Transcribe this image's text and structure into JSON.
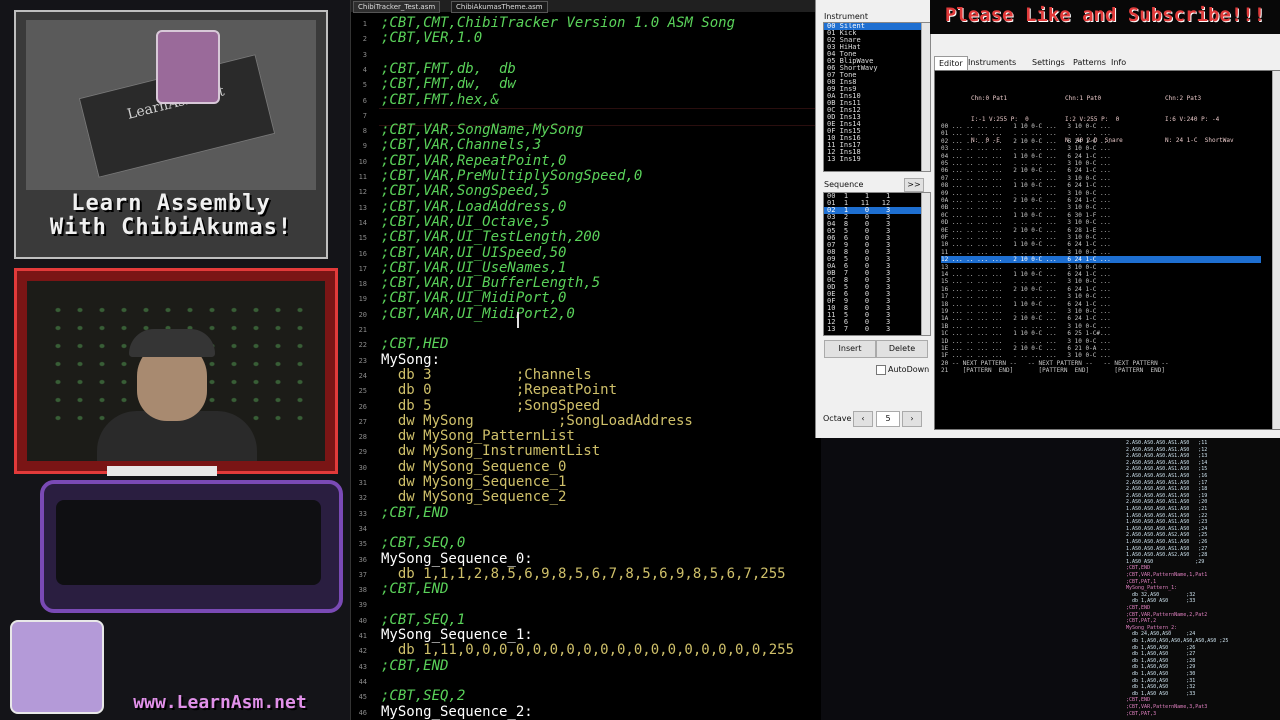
{
  "overlay": {
    "logo_site": "LearnAsm.net",
    "logo_title_1": "Learn Assembly",
    "logo_title_2": "With ChibiAkumas!",
    "url": "www.LearnAsm.net"
  },
  "editor": {
    "tabs": [
      "ChibiTracker_Test.asm",
      "ChibiAkumasTheme.asm"
    ],
    "lines": [
      {
        "n": "1",
        "t": ";CBT,CMT,ChibiTracker Version 1.0 ASM Song",
        "c": "cmt"
      },
      {
        "n": "2",
        "t": ";CBT,VER,1.0",
        "c": "cmt"
      },
      {
        "n": "3",
        "t": "",
        "c": "cmt"
      },
      {
        "n": "4",
        "t": ";CBT,FMT,db,  db",
        "c": "cmt"
      },
      {
        "n": "5",
        "t": ";CBT,FMT,dw,  dw",
        "c": "cmt"
      },
      {
        "n": "6",
        "t": ";CBT,FMT,hex,&",
        "c": "cmt"
      },
      {
        "n": "7",
        "t": "",
        "c": "cmt"
      },
      {
        "n": "8",
        "t": ";CBT,VAR,SongName,MySong",
        "c": "cmt"
      },
      {
        "n": "9",
        "t": ";CBT,VAR,Channels,3",
        "c": "cmt"
      },
      {
        "n": "10",
        "t": ";CBT,VAR,RepeatPoint,0",
        "c": "cmt"
      },
      {
        "n": "11",
        "t": ";CBT,VAR,PreMultiplySongSpeed,0",
        "c": "cmt"
      },
      {
        "n": "12",
        "t": ";CBT,VAR,SongSpeed,5",
        "c": "cmt"
      },
      {
        "n": "13",
        "t": ";CBT,VAR,LoadAddress,0",
        "c": "cmt"
      },
      {
        "n": "14",
        "t": ";CBT,VAR,UI_Octave,5",
        "c": "cmt"
      },
      {
        "n": "15",
        "t": ";CBT,VAR,UI_TestLength,200",
        "c": "cmt"
      },
      {
        "n": "16",
        "t": ";CBT,VAR,UI_UISpeed,50",
        "c": "cmt"
      },
      {
        "n": "17",
        "t": ";CBT,VAR,UI_UseNames,1",
        "c": "cmt"
      },
      {
        "n": "18",
        "t": ";CBT,VAR,UI_BufferLength,5",
        "c": "cmt"
      },
      {
        "n": "19",
        "t": ";CBT,VAR,UI_MidiPort,0",
        "c": "cmt"
      },
      {
        "n": "20",
        "t": ";CBT,VAR,UI_MidiPort2,0",
        "c": "cmt"
      },
      {
        "n": "21",
        "t": "",
        "c": "cmt"
      },
      {
        "n": "22",
        "t": ";CBT,HED",
        "c": "cmt"
      },
      {
        "n": "23",
        "t": "MySong:",
        "c": "lbl"
      },
      {
        "n": "24",
        "t": "  db 3          ;Channels",
        "c": "mix"
      },
      {
        "n": "25",
        "t": "  db 0          ;RepeatPoint",
        "c": "mix"
      },
      {
        "n": "26",
        "t": "  db 5          ;SongSpeed",
        "c": "mix"
      },
      {
        "n": "27",
        "t": "  dw MySong          ;SongLoadAddress",
        "c": "mix"
      },
      {
        "n": "28",
        "t": "  dw MySong_PatternList",
        "c": "kw"
      },
      {
        "n": "29",
        "t": "  dw MySong_InstrumentList",
        "c": "kw"
      },
      {
        "n": "30",
        "t": "  dw MySong_Sequence_0",
        "c": "kw"
      },
      {
        "n": "31",
        "t": "  dw MySong_Sequence_1",
        "c": "kw"
      },
      {
        "n": "32",
        "t": "  dw MySong_Sequence_2",
        "c": "kw"
      },
      {
        "n": "33",
        "t": ";CBT,END",
        "c": "cmt"
      },
      {
        "n": "34",
        "t": "",
        "c": "cmt"
      },
      {
        "n": "35",
        "t": ";CBT,SEQ,0",
        "c": "cmt"
      },
      {
        "n": "36",
        "t": "MySong_Sequence_0:",
        "c": "lbl"
      },
      {
        "n": "37",
        "t": "  db 1,1,1,2,8,5,6,9,8,5,6,7,8,5,6,9,8,5,6,7,255",
        "c": "kw"
      },
      {
        "n": "38",
        "t": ";CBT,END",
        "c": "cmt"
      },
      {
        "n": "39",
        "t": "",
        "c": "cmt"
      },
      {
        "n": "40",
        "t": ";CBT,SEQ,1",
        "c": "cmt"
      },
      {
        "n": "41",
        "t": "MySong_Sequence_1:",
        "c": "lbl"
      },
      {
        "n": "42",
        "t": "  db 1,11,0,0,0,0,0,0,0,0,0,0,0,0,0,0,0,0,0,0,255",
        "c": "kw"
      },
      {
        "n": "43",
        "t": ";CBT,END",
        "c": "cmt"
      },
      {
        "n": "44",
        "t": "",
        "c": "cmt"
      },
      {
        "n": "45",
        "t": ";CBT,SEQ,2",
        "c": "cmt"
      },
      {
        "n": "46",
        "t": "MySong_Sequence_2:",
        "c": "lbl"
      }
    ]
  },
  "subscribe": "Please Like and Subscribe!!!",
  "tracker": {
    "instrument_label": "Instrument",
    "instruments": [
      "00 Silent",
      "01 Kick",
      "02 Snare",
      "03 HiHat",
      "04 Tone",
      "05 BlipWave",
      "06 ShortWavy",
      "07 Tone",
      "08 Ins8",
      "09 Ins9",
      "0A Ins10",
      "0B Ins11",
      "0C Ins12",
      "0D Ins13",
      "0E Ins14",
      "0F Ins15",
      "10 Ins16",
      "11 Ins17",
      "12 Ins18",
      "13 Ins19"
    ],
    "sequence_label": "Sequence",
    "sequence_rows": [
      "00  1    1    1",
      "01  1   11   12",
      "02  1    0    3",
      "03  2    0    3",
      "04  8    0    3",
      "05  5    0    3",
      "06  6    0    3",
      "07  9    0    3",
      "08  8    0    3",
      "09  5    0    3",
      "0A  6    0    3",
      "0B  7    0    3",
      "0C  8    0    3",
      "0D  5    0    3",
      "0E  6    0    3",
      "0F  9    0    3",
      "10  8    0    3",
      "11  5    0    3",
      "12  6    0    3",
      "13  7    0    3"
    ],
    "insert": "Insert",
    "delete": "Delete",
    "autodown": "AutoDown",
    "octave_label": "Octave",
    "octave_value": "5",
    "expand": ">>",
    "tabs": [
      "Editor",
      "Instruments",
      "Settings",
      "Patterns",
      "Info"
    ],
    "channels": [
      {
        "head": "Chn:0 Pat1",
        "info": "I:-1 V:255 P:  0",
        "note": "N:  0 -E"
      },
      {
        "head": "Chn:1 Pat0",
        "info": "I:2 V:255 P:  0",
        "note": "N: 40 2-D  Snare"
      },
      {
        "head": "Chn:2 Pat3",
        "info": "I:6 V:240 P: -4",
        "note": "N: 24 1-C  ShortWav"
      }
    ],
    "pattern_rows": [
      "00 ... .. ... ...   1 10 0-C ...   3 10 0-C ...",
      "01 ... .. ... ...   . .. ... ...   . .. ... ...",
      "02 ... .. ... ...   2 10 0-C ...   6 24 1-C ...",
      "03 ... .. ... ...   . .. ... ...   3 10 0-C ...",
      "04 ... .. ... ...   1 10 0-C ...   6 24 1-C ...",
      "05 ... .. ... ...   . .. ... ...   3 10 0-C ...",
      "06 ... .. ... ...   2 10 0-C ...   6 24 1-C ...",
      "07 ... .. ... ...   . .. ... ...   3 10 0-C ...",
      "08 ... .. ... ...   1 10 0-C ...   6 24 1-C ...",
      "09 ... .. ... ...   . .. ... ...   3 10 0-C ...",
      "0A ... .. ... ...   2 10 0-C ...   6 24 1-C ...",
      "0B ... .. ... ...   . .. ... ...   3 10 0-C ...",
      "0C ... .. ... ...   1 10 0-C ...   6 30 1-F ...",
      "0D ... .. ... ...   . .. ... ...   3 10 0-C ...",
      "0E ... .. ... ...   2 10 0-C ...   6 28 1-E ...",
      "0F ... .. ... ...   . .. ... ...   3 10 0-C ...",
      "10 ... .. ... ...   1 10 0-C ...   6 24 1-C ...",
      "11 ... .. ... ...   . .. ... ...   3 10 0-C ...",
      "12 ... .. ... ...   2 10 0-C ...   6 24 1-C ...",
      "13 ... .. ... ...   . .. ... ...   3 10 0-C ...",
      "14 ... .. ... ...   1 10 0-C ...   6 24 1-C ...",
      "15 ... .. ... ...   . .. ... ...   3 10 0-C ...",
      "16 ... .. ... ...   2 10 0-C ...   6 24 1-C ...",
      "17 ... .. ... ...   . .. ... ...   3 10 0-C ...",
      "18 ... .. ... ...   1 10 0-C ...   6 24 1-C ...",
      "19 ... .. ... ...   . .. ... ...   3 10 0-C ...",
      "1A ... .. ... ...   2 10 0-C ...   6 24 1-C ...",
      "1B ... .. ... ...   . .. ... ...   3 10 0-C ...",
      "1C ... .. ... ...   1 10 0-C ...   6 25 1-C#...",
      "1D ... .. ... ...   . .. ... ...   3 10 0-C ...",
      "1E ... .. ... ...   2 10 0-C ...   6 21 0-A ...",
      "1F ... .. ... ...   . .. ... ...   3 10 0-C ...",
      "20 -- NEXT PATTERN --   -- NEXT PATTERN --   -- NEXT PATTERN --",
      "21    [PATTERN  END]       [PATTERN  END]       [PATTERN  END]"
    ],
    "highlight_row": 18
  },
  "right_strip": {
    "lines": [
      "2.AS0.AS0.AS0.AS1.AS0   ;11",
      "2.AS0.AS0.AS0.AS1.AS0   ;12",
      "2.AS0.AS0.AS0.AS1.AS0   ;13",
      "2.AS0.AS0.AS0.AS1.AS0   ;14",
      "2.AS0.AS0.AS0.AS1.AS0   ;15",
      "2.AS0.AS0.AS0.AS1.AS0   ;16",
      "2.AS0.AS0.AS0.AS1.AS0   ;17",
      "2.AS0.AS0.AS0.AS1.AS0   ;18",
      "2.AS0.AS0.AS0.AS1.AS0   ;19",
      "2.AS0.AS0.AS0.AS1.AS0   ;20",
      "1.AS0.AS0.AS0.AS1.AS0   ;21",
      "1.AS0.AS0.AS0.AS1.AS0   ;22",
      "1.AS0.AS0.AS0.AS1.AS0   ;23",
      "1.AS0.AS0.AS0.AS1.AS0   ;24",
      "2.AS0.AS0.AS0.AS2.AS0   ;25",
      "1.AS0.AS0.AS0.AS1.AS0   ;26",
      "1.AS0.AS0.AS0.AS1.AS0   ;27",
      "1.AS0.AS0.AS0.AS2.AS0   ;28",
      "1.AS0 AS0              ;29",
      ";CBT,END",
      ";CBT,VAR,PatternName,1,Pat1",
      ";CBT,PAT,1",
      "MySong_Pattern_1:",
      "  db 32,AS0         ;32",
      "  db 1,AS0 AS0      ;33",
      ";CBT,END",
      ";CBT,VAR,PatternName,2,Pat2",
      ";CBT,PAT,2",
      "MySong_Pattern_2:",
      "  db 24,AS0,AS0     ;24",
      "  db 1,AS0,AS0,AS0,AS0,AS0,AS0 ;25",
      "  db 1,AS0,AS0      ;26",
      "  db 1,AS0,AS0      ;27",
      "  db 1,AS0,AS0      ;28",
      "  db 1,AS0,AS0      ;29",
      "  db 1,AS0,AS0      ;30",
      "  db 1,AS0,AS0      ;31",
      "  db 1,AS0,AS0      ;32",
      "  db 1,AS0 AS0      ;33",
      ";CBT,END",
      ";CBT,VAR,PatternName,3,Pat3",
      ";CBT,PAT,3"
    ]
  }
}
